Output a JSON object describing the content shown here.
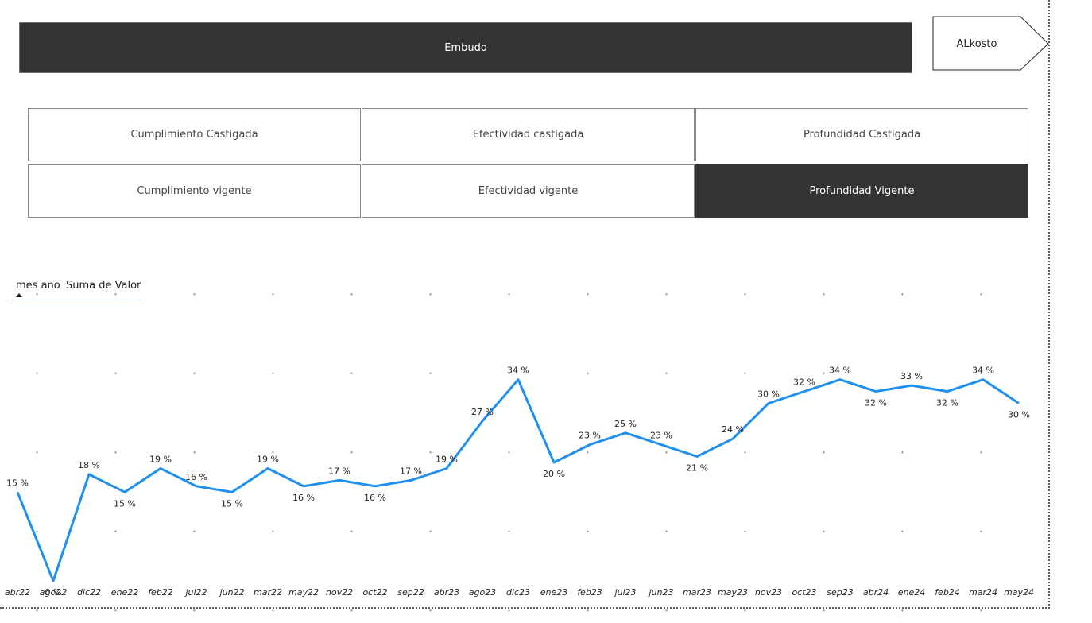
{
  "header": {
    "funnel_label": "Embudo",
    "store_label": "ALkosto"
  },
  "slicers": [
    {
      "label": "Cumplimiento Castigada",
      "active": false
    },
    {
      "label": "Efectividad castigada",
      "active": false
    },
    {
      "label": "Profundidad Castigada",
      "active": false
    },
    {
      "label": "Cumplimiento vigente",
      "active": false
    },
    {
      "label": "Efectividad vigente",
      "active": false
    },
    {
      "label": "Profundidad Vigente",
      "active": true
    }
  ],
  "table_header": {
    "col1": "mes ano",
    "col2": "Suma de Valor"
  },
  "colors": {
    "line": "#1f8ff0",
    "button_dark": "#333333"
  },
  "chart_data": {
    "type": "line",
    "categories": [
      "abr22",
      "ago22",
      "dic22",
      "ene22",
      "feb22",
      "jul22",
      "jun22",
      "mar22",
      "may22",
      "nov22",
      "oct22",
      "sep22",
      "abr23",
      "ago23",
      "dic23",
      "ene23",
      "feb23",
      "jul23",
      "jun23",
      "mar23",
      "may23",
      "nov23",
      "oct23",
      "sep23",
      "abr24",
      "ene24",
      "feb24",
      "mar24",
      "may24"
    ],
    "values": [
      15,
      0,
      18,
      15,
      19,
      16,
      15,
      19,
      16,
      17,
      16,
      17,
      19,
      27,
      34,
      20,
      23,
      25,
      23,
      21,
      24,
      30,
      32,
      34,
      32,
      33,
      32,
      34,
      30
    ],
    "labels": [
      "15 %",
      "0 %",
      "18 %",
      "15 %",
      "19 %",
      "16 %",
      "15 %",
      "19 %",
      "16 %",
      "17 %",
      "16 %",
      "17 %",
      "19 %",
      "27 %",
      "34 %",
      "20 %",
      "23 %",
      "25 %",
      "23 %",
      "21 %",
      "24 %",
      "30 %",
      "32 %",
      "34 %",
      "32 %",
      "33 %",
      "32 %",
      "34 %",
      "30 %"
    ],
    "grid": "dotted",
    "legend": "none"
  }
}
